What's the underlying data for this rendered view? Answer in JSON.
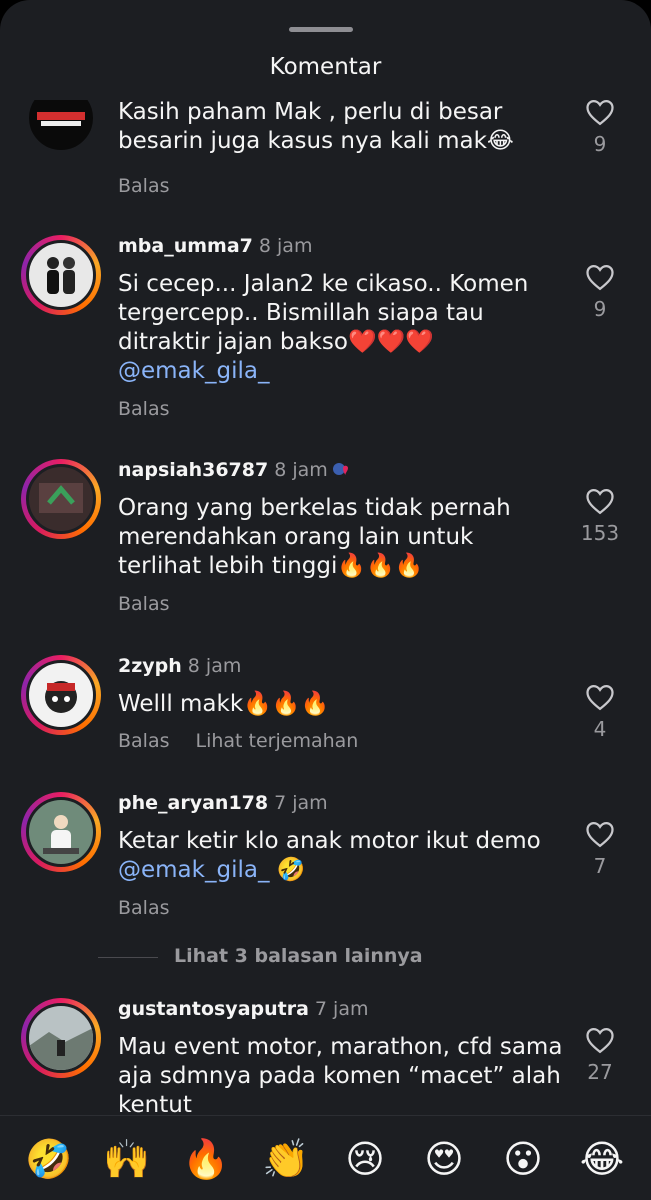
{
  "header": {
    "title": "Komentar"
  },
  "comments": [
    {
      "text": "Kasih paham Mak , perlu di besar besarin juga kasus nya kali mak😂",
      "likes": "9",
      "actions": [
        "Balas"
      ]
    },
    {
      "username": "mba_umma7",
      "time": "8 jam",
      "text": "Si cecep... Jalan2 ke cikaso.. Komen tergercepp.. Bismillah siapa tau ditraktir jajan bakso❤️❤️❤️",
      "mention": "@emak_gila_",
      "likes": "9",
      "actions": [
        "Balas"
      ]
    },
    {
      "username": "napsiah36787",
      "time": "8 jam",
      "text": "Orang yang berkelas tidak pernah merendahkan orang lain untuk terlihat lebih tinggi🔥🔥🔥",
      "likes": "153",
      "actions": [
        "Balas"
      ]
    },
    {
      "username": "2zyph",
      "time": "8 jam",
      "text": "Welll makk🔥🔥🔥",
      "likes": "4",
      "actions": [
        "Balas",
        "Lihat terjemahan"
      ]
    },
    {
      "username": "phe_aryan178",
      "time": "7 jam",
      "text": "Ketar ketir klo anak motor ikut demo",
      "mention": "@emak_gila_",
      "mention_suffix": " 🤣",
      "likes": "7",
      "actions": [
        "Balas"
      ]
    },
    {
      "username": "gustantosyaputra",
      "time": "7 jam",
      "text": "Mau event motor, marathon, cfd sama aja sdmnya pada komen “macet” alah kentut",
      "likes": "27"
    }
  ],
  "view_more_replies": "Lihat 3 balasan lainnya",
  "emoji_bar": [
    "🤣",
    "🙌",
    "🔥",
    "👏",
    "😢",
    "😍",
    "😮",
    "😂"
  ],
  "colors": {
    "background": "#1c1e22",
    "mention": "#8ab4f8",
    "muted": "#9a9a9e"
  }
}
